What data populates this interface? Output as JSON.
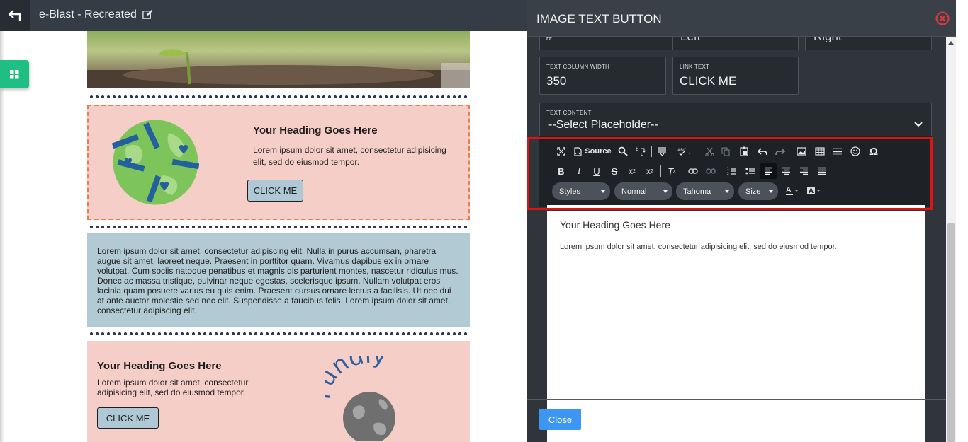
{
  "topbar": {
    "title": "e-Blast - Recreated",
    "back_icon": "back-arrow-icon",
    "edit_icon": "edit-icon"
  },
  "email": {
    "block1": {
      "heading": "Your Heading Goes Here",
      "text": "Lorem ipsum dolor sit amet, consectetur adipisicing elit, sed do eiusmod tempor.",
      "button": "CLICK ME"
    },
    "block2": {
      "text": "Lorem ipsum dolor sit amet, consectetur adipiscing elit. Nulla in purus accumsan, pharetra augue sit amet, laoreet neque. Praesent in porttitor quam. Vivamus dapibus ex in ornare volutpat. Cum sociis natoque penatibus et magnis dis parturient montes, nascetur ridiculus mus. Donec ac massa tristique, pulvinar neque egestas, scelerisque ipsum. Nullam volutpat eros lacinia quam posuere varius eu quis enim. Praesent cursus ornare lectus a facilisis. Ut nec dui at ante auctor molestie sed nec elit. Suspendisse a faucibus felis. Lorem ipsum dolor sit amet, consectetur adipiscing elit."
    },
    "block3": {
      "heading": "Your Heading Goes Here",
      "text": "Lorem ipsum dolor sit amet, consectetur adipisicing elit, sed do eiusmod tempor.",
      "button": "CLICK ME",
      "logo_text": "Fundly"
    }
  },
  "panel": {
    "title": "IMAGE TEXT BUTTON",
    "partial_fields": [
      "#",
      "Left",
      "Right"
    ],
    "text_column_width": {
      "label": "TEXT COLUMN WIDTH",
      "value": "350"
    },
    "link_text": {
      "label": "LINK TEXT",
      "value": "CLICK ME"
    },
    "text_content": {
      "label": "TEXT CONTENT",
      "value": "--Select Placeholder--"
    },
    "toolbar": {
      "source_label": "Source",
      "styles": "Styles",
      "format": "Normal",
      "font": "Tahoma",
      "size": "Size"
    },
    "editor": {
      "heading": "Your Heading Goes Here",
      "text": "Lorem ipsum dolor sit amet, consectetur adipisicing elit, sed do eiusmod tempor."
    },
    "close_button": "Close"
  },
  "colors": {
    "panel_bg": "#2f353b",
    "highlight": "#e01313",
    "accent_green": "#1fbf84",
    "close_blue": "#3d97f2",
    "peach": "#f5cfc7",
    "blue_block": "#b1cad3"
  }
}
